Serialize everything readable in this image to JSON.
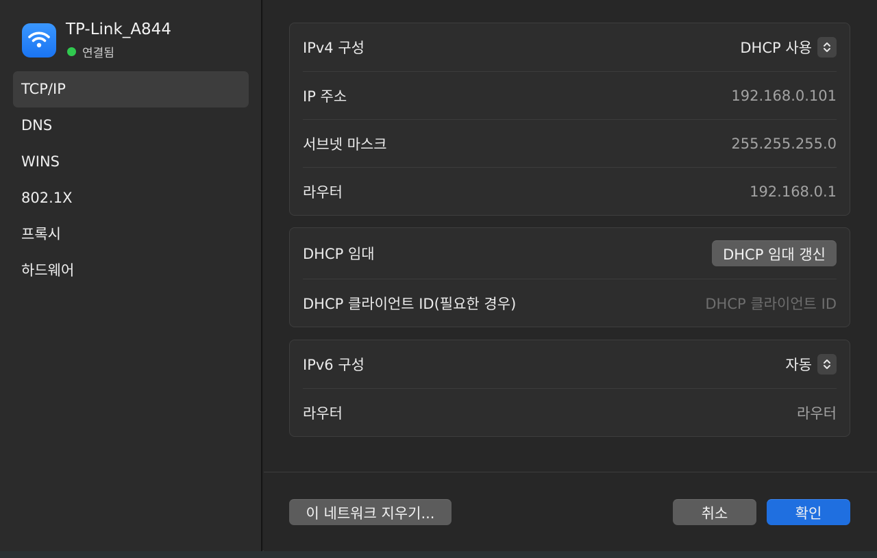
{
  "network": {
    "name": "TP-Link_A844",
    "status": "연결됨",
    "icon": "wifi-icon",
    "status_color": "#30c94f"
  },
  "sidebar": {
    "items": [
      {
        "label": "TCP/IP",
        "active": true
      },
      {
        "label": "DNS"
      },
      {
        "label": "WINS"
      },
      {
        "label": "802.1X"
      },
      {
        "label": "프록시"
      },
      {
        "label": "하드웨어"
      }
    ]
  },
  "ipv4": {
    "config_label": "IPv4 구성",
    "config_value": "DHCP 사용",
    "ip_label": "IP 주소",
    "ip_value": "192.168.0.101",
    "subnet_label": "서브넷 마스크",
    "subnet_value": "255.255.255.0",
    "router_label": "라우터",
    "router_value": "192.168.0.1"
  },
  "dhcp": {
    "lease_label": "DHCP 임대",
    "renew_button": "DHCP 임대 갱신",
    "client_id_label": "DHCP 클라이언트 ID(필요한 경우)",
    "client_id_placeholder": "DHCP 클라이언트 ID"
  },
  "ipv6": {
    "config_label": "IPv6 구성",
    "config_value": "자동",
    "router_label": "라우터",
    "router_value": "라우터"
  },
  "footer": {
    "forget_button": "이 네트워크 지우기...",
    "cancel_button": "취소",
    "ok_button": "확인"
  },
  "colors": {
    "accent": "#1f6fe0"
  }
}
